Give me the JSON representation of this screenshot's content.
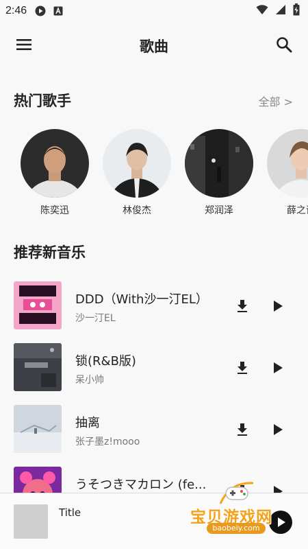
{
  "status_bar": {
    "time": "2:46"
  },
  "header": {
    "title": "歌曲"
  },
  "hot_artists": {
    "title": "热门歌手",
    "see_all": "全部 >",
    "items": [
      {
        "name": "陈奕迅"
      },
      {
        "name": "林俊杰"
      },
      {
        "name": "郑润泽"
      },
      {
        "name": "薛之谦"
      }
    ]
  },
  "new_music": {
    "title": "推荐新音乐",
    "songs": [
      {
        "title": "DDD（With沙一汀EL）",
        "artist": "沙一汀EL"
      },
      {
        "title": "锁(R&B版)",
        "artist": "呆小帅"
      },
      {
        "title": "抽离",
        "artist": "张子墨z!mooo"
      },
      {
        "title": "うそつきマカロン (fe...",
        "artist": ""
      }
    ]
  },
  "player": {
    "title": "Title"
  },
  "watermark": {
    "text": "宝贝游戏网",
    "url": "baobeiy.com"
  },
  "colors": {
    "accent": "#f5a21a",
    "background": "#f8f8f8",
    "text": "#222222",
    "secondary_text": "#777777"
  }
}
